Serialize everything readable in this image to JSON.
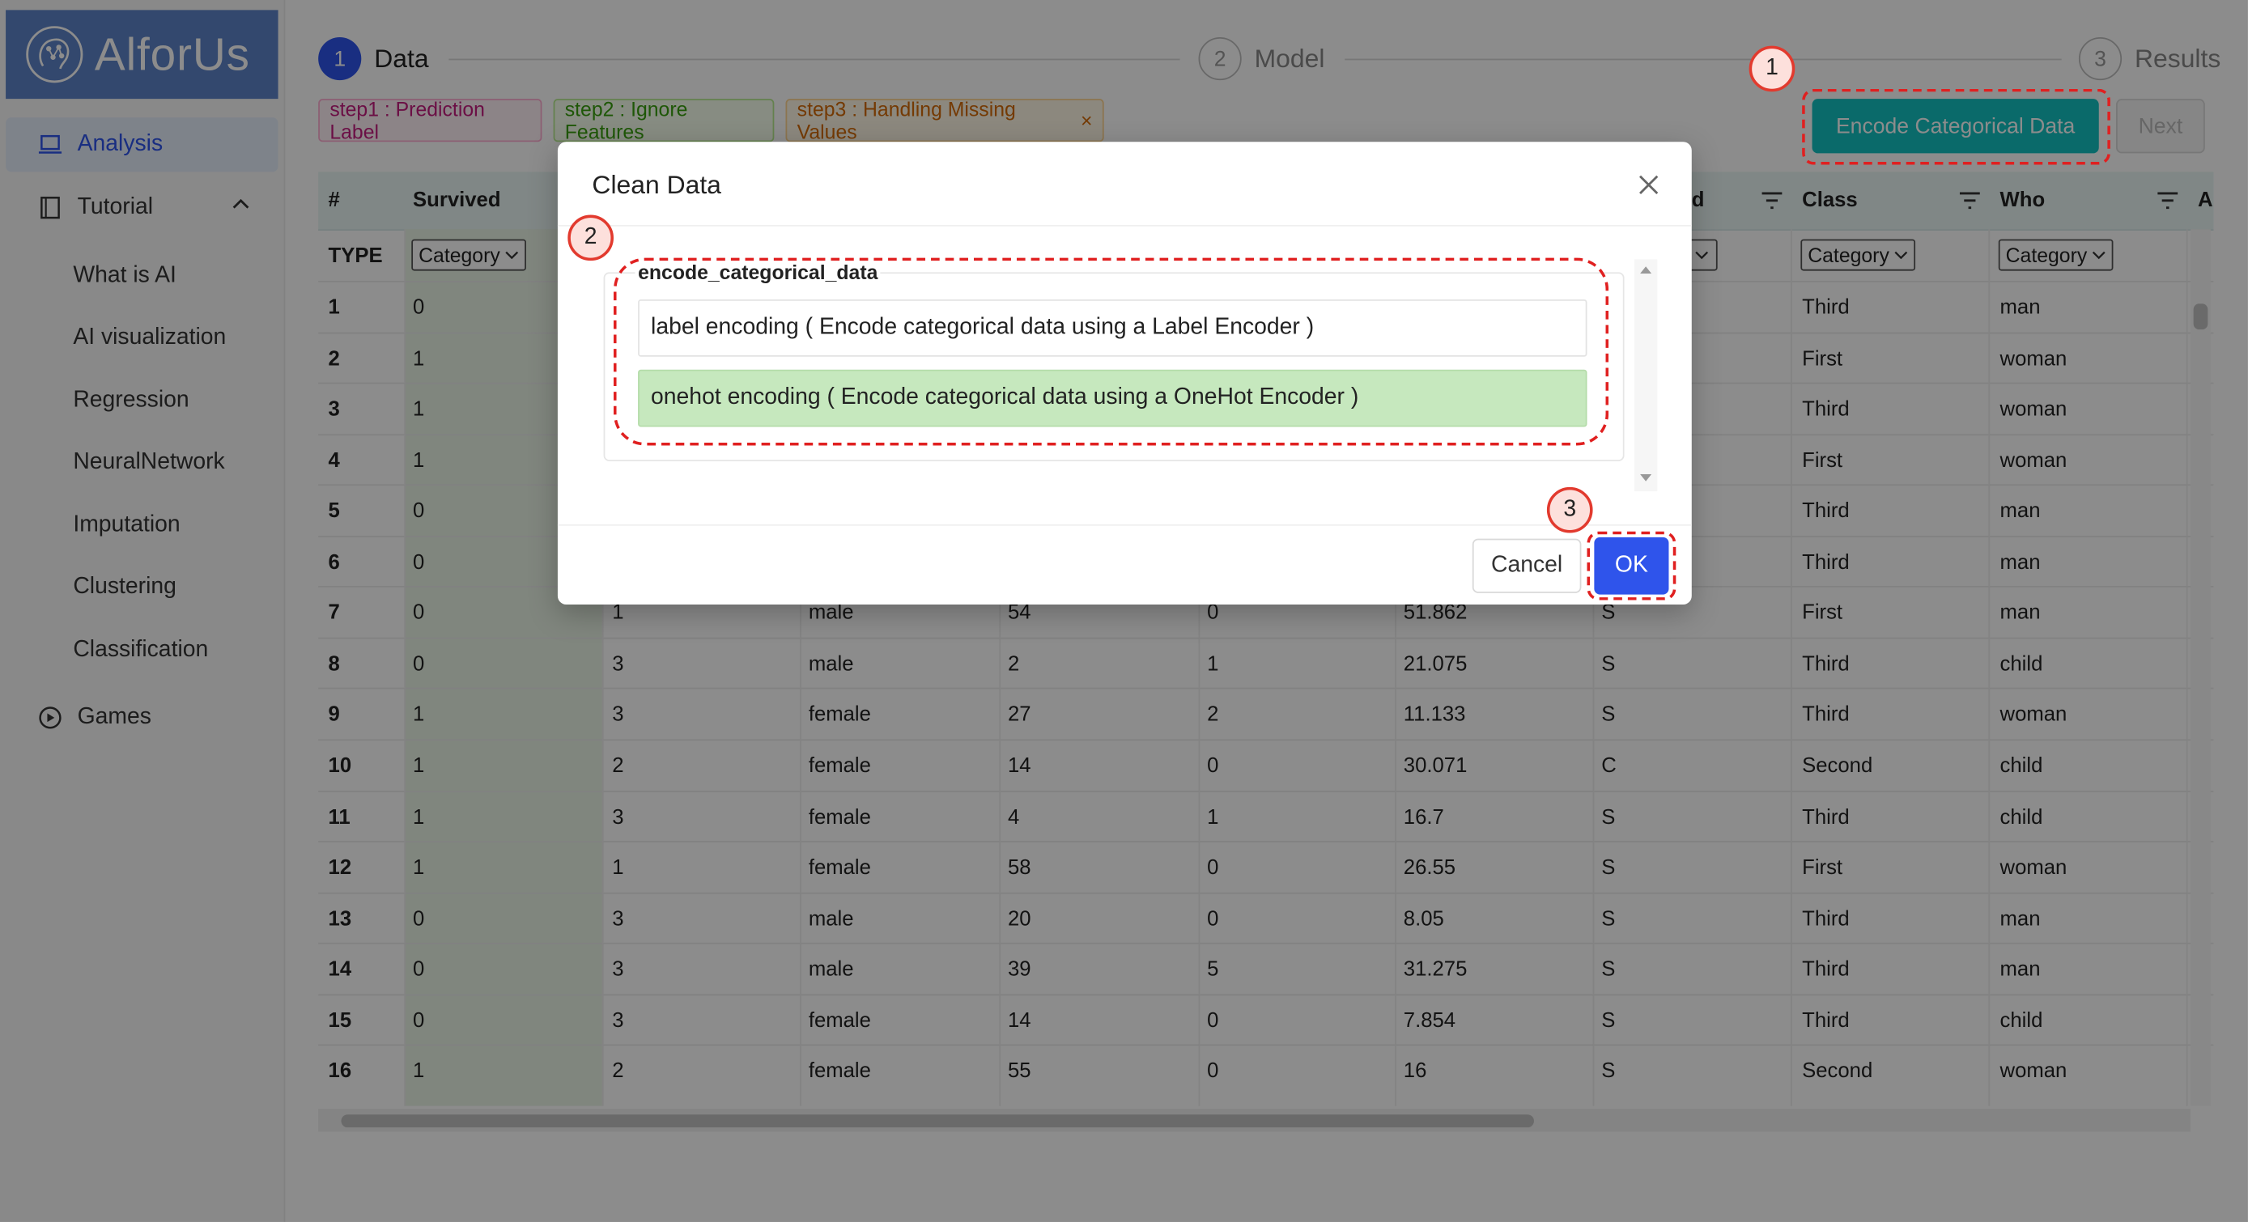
{
  "app": {
    "brand": "AlforUs"
  },
  "sidebar": {
    "items": [
      {
        "label": "Analysis",
        "icon": "laptop-icon"
      },
      {
        "label": "Tutorial",
        "icon": "book-icon"
      },
      {
        "label": "What is AI"
      },
      {
        "label": "AI visualization"
      },
      {
        "label": "Regression"
      },
      {
        "label": "NeuralNetwork"
      },
      {
        "label": "Imputation"
      },
      {
        "label": "Clustering"
      },
      {
        "label": "Classification"
      },
      {
        "label": "Games",
        "icon": "play-circle-icon"
      }
    ]
  },
  "steps": [
    {
      "num": "1",
      "label": "Data"
    },
    {
      "num": "2",
      "label": "Model"
    },
    {
      "num": "3",
      "label": "Results"
    }
  ],
  "tags": [
    {
      "label": "step1 : Prediction Label"
    },
    {
      "label": "step2 : Ignore Features"
    },
    {
      "label": "step3 : Handling Missing Values",
      "close": "×"
    }
  ],
  "toolbar": {
    "encode_label": "Encode Categorical Data",
    "next_label": "Next"
  },
  "table": {
    "headers": {
      "index": "#",
      "survived": "Survived",
      "partial": "d",
      "class": "Class",
      "who": "Who",
      "edge": "A"
    },
    "type_label": "TYPE",
    "select_value": "Category",
    "rows": [
      {
        "n": "1",
        "survived": "0",
        "pclass": "",
        "sex": "",
        "age": "",
        "sib": "",
        "fare": "",
        "emb": "",
        "class": "Third",
        "who": "man"
      },
      {
        "n": "2",
        "survived": "1",
        "pclass": "",
        "sex": "",
        "age": "",
        "sib": "",
        "fare": "",
        "emb": "",
        "class": "First",
        "who": "woman"
      },
      {
        "n": "3",
        "survived": "1",
        "pclass": "",
        "sex": "",
        "age": "",
        "sib": "",
        "fare": "",
        "emb": "",
        "class": "Third",
        "who": "woman"
      },
      {
        "n": "4",
        "survived": "1",
        "pclass": "",
        "sex": "",
        "age": "",
        "sib": "",
        "fare": "",
        "emb": "",
        "class": "First",
        "who": "woman"
      },
      {
        "n": "5",
        "survived": "0",
        "pclass": "",
        "sex": "",
        "age": "",
        "sib": "",
        "fare": "",
        "emb": "",
        "class": "Third",
        "who": "man"
      },
      {
        "n": "6",
        "survived": "0",
        "pclass": "",
        "sex": "",
        "age": "",
        "sib": "",
        "fare": "",
        "emb": "",
        "class": "Third",
        "who": "man"
      },
      {
        "n": "7",
        "survived": "0",
        "pclass": "1",
        "sex": "male",
        "age": "54",
        "sib": "0",
        "fare": "51.862",
        "emb": "S",
        "class": "First",
        "who": "man"
      },
      {
        "n": "8",
        "survived": "0",
        "pclass": "3",
        "sex": "male",
        "age": "2",
        "sib": "1",
        "fare": "21.075",
        "emb": "S",
        "class": "Third",
        "who": "child"
      },
      {
        "n": "9",
        "survived": "1",
        "pclass": "3",
        "sex": "female",
        "age": "27",
        "sib": "2",
        "fare": "11.133",
        "emb": "S",
        "class": "Third",
        "who": "woman"
      },
      {
        "n": "10",
        "survived": "1",
        "pclass": "2",
        "sex": "female",
        "age": "14",
        "sib": "0",
        "fare": "30.071",
        "emb": "C",
        "class": "Second",
        "who": "child"
      },
      {
        "n": "11",
        "survived": "1",
        "pclass": "3",
        "sex": "female",
        "age": "4",
        "sib": "1",
        "fare": "16.7",
        "emb": "S",
        "class": "Third",
        "who": "child"
      },
      {
        "n": "12",
        "survived": "1",
        "pclass": "1",
        "sex": "female",
        "age": "58",
        "sib": "0",
        "fare": "26.55",
        "emb": "S",
        "class": "First",
        "who": "woman"
      },
      {
        "n": "13",
        "survived": "0",
        "pclass": "3",
        "sex": "male",
        "age": "20",
        "sib": "0",
        "fare": "8.05",
        "emb": "S",
        "class": "Third",
        "who": "man"
      },
      {
        "n": "14",
        "survived": "0",
        "pclass": "3",
        "sex": "male",
        "age": "39",
        "sib": "5",
        "fare": "31.275",
        "emb": "S",
        "class": "Third",
        "who": "man"
      },
      {
        "n": "15",
        "survived": "0",
        "pclass": "3",
        "sex": "female",
        "age": "14",
        "sib": "0",
        "fare": "7.854",
        "emb": "S",
        "class": "Third",
        "who": "child"
      },
      {
        "n": "16",
        "survived": "1",
        "pclass": "2",
        "sex": "female",
        "age": "55",
        "sib": "0",
        "fare": "16",
        "emb": "S",
        "class": "Second",
        "who": "woman"
      }
    ]
  },
  "modal": {
    "title": "Clean Data",
    "group_label": "encode_categorical_data",
    "options": [
      {
        "label": "label encoding ( Encode categorical data using a Label Encoder )",
        "selected": false
      },
      {
        "label": "onehot encoding ( Encode categorical data using a OneHot Encoder )",
        "selected": true
      }
    ],
    "cancel_label": "Cancel",
    "ok_label": "OK"
  },
  "annotations": [
    "1",
    "2",
    "3"
  ],
  "colors": {
    "primary": "#2f54eb",
    "teal": "#13c2c2",
    "selected_option": "#c6e8be",
    "annotation_red": "#e02020"
  }
}
